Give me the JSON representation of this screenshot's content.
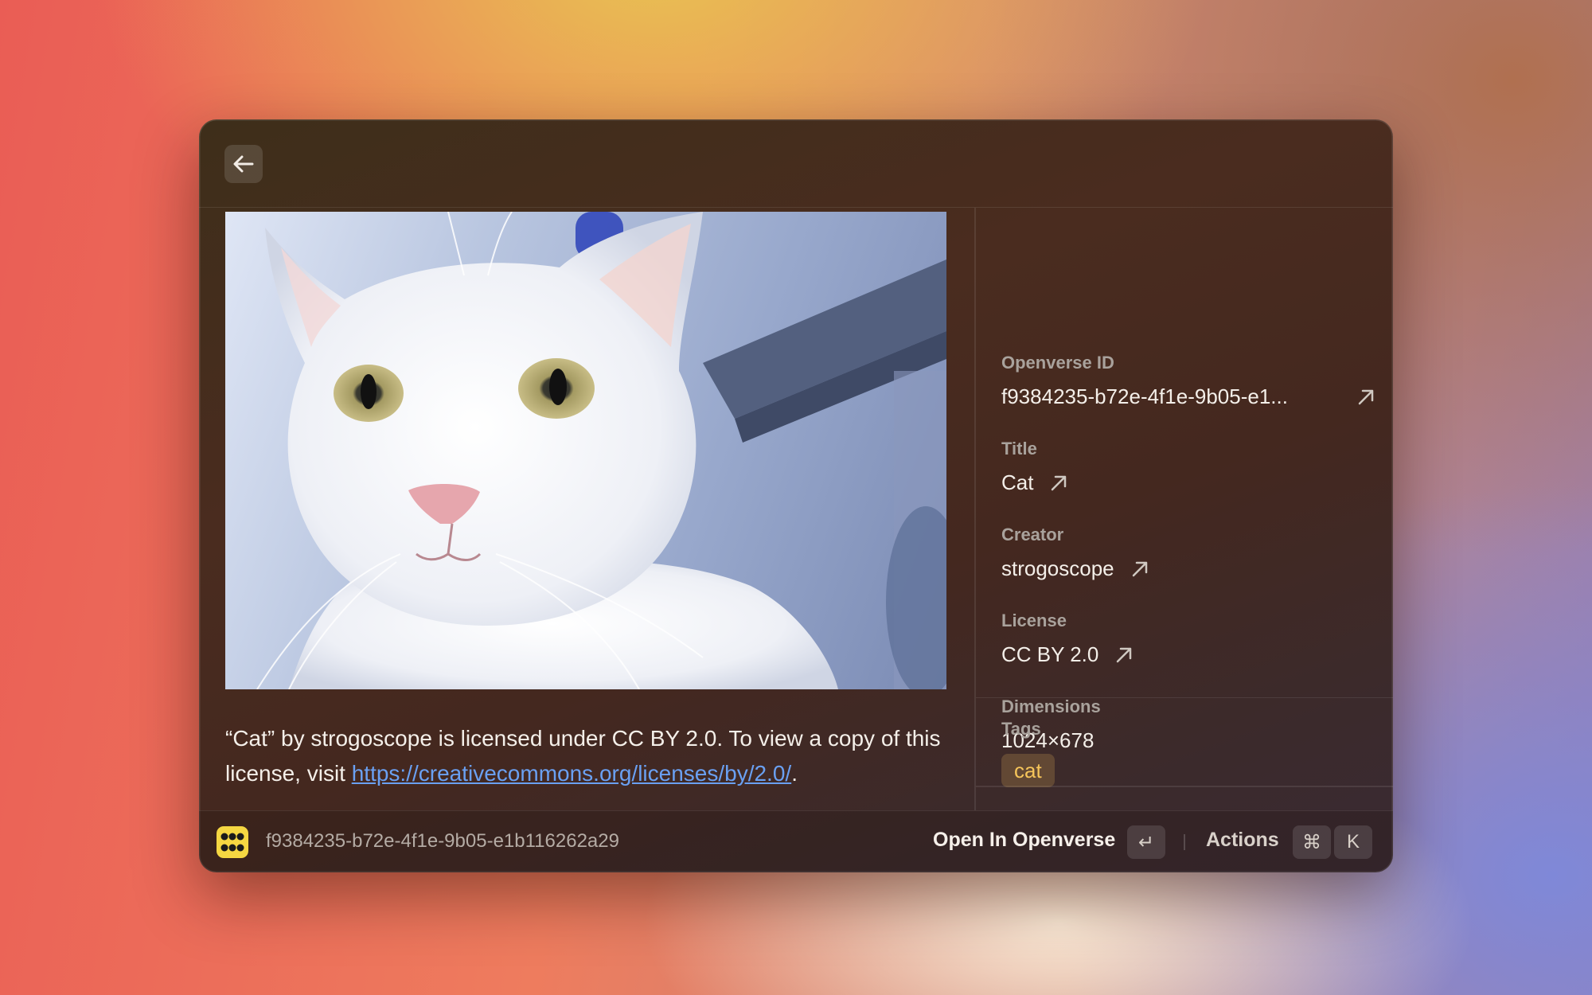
{
  "window": {
    "back_icon": "arrow-left-icon"
  },
  "preview": {
    "image_subject": "white cat photo"
  },
  "attribution": {
    "text_before_link": "“Cat” by strogoscope is licensed under CC BY 2.0. To view a copy of this license, visit ",
    "link": "https://creativecommons.org/licenses/by/2.0/",
    "text_after_link": "."
  },
  "metadata": {
    "openverse_id": {
      "label": "Openverse ID",
      "value": "f9384235-b72e-4f1e-9b05-e1..."
    },
    "title": {
      "label": "Title",
      "value": "Cat"
    },
    "creator": {
      "label": "Creator",
      "value": "strogoscope"
    },
    "license": {
      "label": "License",
      "value": "CC BY 2.0"
    },
    "dimensions": {
      "label": "Dimensions",
      "value": "1024×678"
    },
    "tags": {
      "label": "Tags",
      "items": [
        "cat"
      ]
    }
  },
  "footer": {
    "id": "f9384235-b72e-4f1e-9b05-e1b116262a29",
    "primary_action": "Open In Openverse",
    "primary_shortcut": "↵",
    "actions_label": "Actions",
    "actions_shortcut_mod": "⌘",
    "actions_shortcut_key": "K"
  },
  "colors": {
    "accent_link": "#6aa0f2",
    "tag_text": "#f6c55a",
    "app_logo": "#f5d742"
  }
}
